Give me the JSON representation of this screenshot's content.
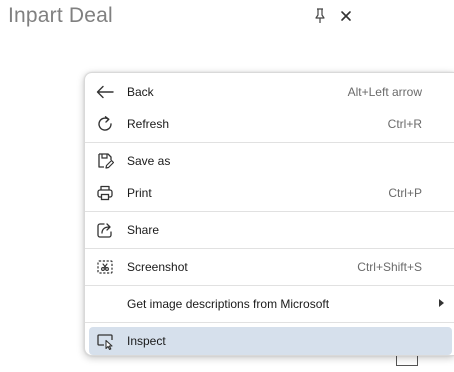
{
  "page": {
    "title": "Inpart Deal"
  },
  "toolbar": {
    "pin_icon": "pin-icon",
    "close_icon": "close-icon"
  },
  "context_menu": {
    "items": [
      {
        "label": "Back",
        "shortcut": "Alt+Left arrow",
        "icon": "back-arrow-icon"
      },
      {
        "label": "Refresh",
        "shortcut": "Ctrl+R",
        "icon": "refresh-icon"
      },
      {
        "label": "Save as",
        "shortcut": "",
        "icon": "save-as-icon"
      },
      {
        "label": "Print",
        "shortcut": "Ctrl+P",
        "icon": "print-icon"
      },
      {
        "label": "Share",
        "shortcut": "",
        "icon": "share-icon"
      },
      {
        "label": "Screenshot",
        "shortcut": "Ctrl+Shift+S",
        "icon": "screenshot-icon"
      },
      {
        "label": "Get image descriptions from Microsoft",
        "shortcut": "",
        "icon": "",
        "has_submenu": true
      },
      {
        "label": "Inspect",
        "shortcut": "",
        "icon": "inspect-icon",
        "highlighted": true
      }
    ]
  },
  "colors": {
    "highlight": "#d6e0ec",
    "title_text": "#808080",
    "shortcut_text": "#6b6b6b"
  }
}
